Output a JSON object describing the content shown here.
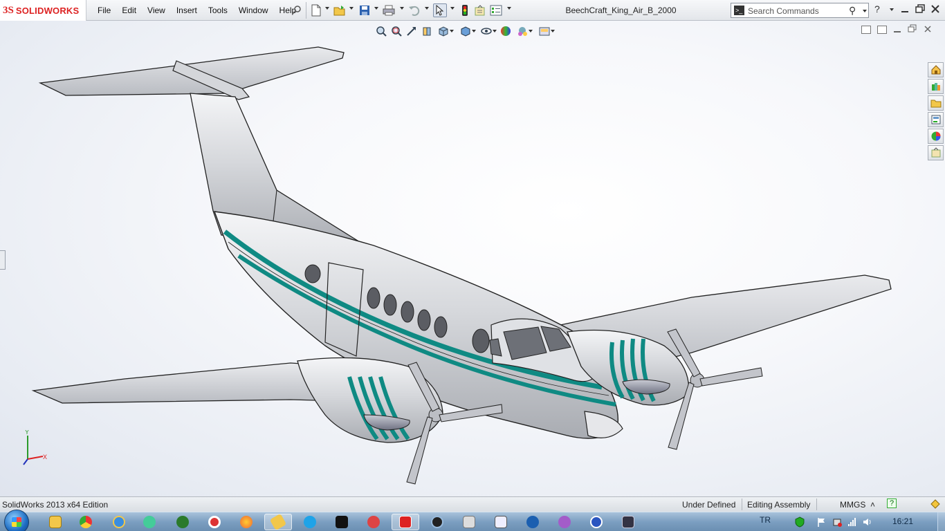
{
  "app": {
    "logo_prefix": "3S",
    "logo_name": "SOLIDWORKS",
    "document_title": "BeechCraft_King_Air_B_2000"
  },
  "menu": {
    "items": [
      "File",
      "Edit",
      "View",
      "Insert",
      "Tools",
      "Window",
      "Help"
    ]
  },
  "toolbar": {
    "icons": [
      "new-document-icon",
      "open-icon",
      "save-icon",
      "print-icon",
      "undo-icon",
      "select-icon",
      "rebuild-icon",
      "file-properties-icon",
      "options-icon"
    ]
  },
  "search": {
    "placeholder": "Search Commands",
    "help_glyph": "?"
  },
  "heads_up_toolbar": {
    "icons": [
      "zoom-to-fit-icon",
      "zoom-to-area-icon",
      "previous-view-icon",
      "section-view-icon",
      "view-orientation-icon",
      "display-style-icon",
      "hide-show-items-icon",
      "edit-appearance-icon",
      "apply-scene-icon",
      "view-settings-icon"
    ]
  },
  "task_pane": {
    "icons": [
      "solidworks-resources-icon",
      "design-library-icon",
      "file-explorer-icon",
      "view-palette-icon",
      "appearances-icon",
      "custom-properties-icon"
    ]
  },
  "triad": {
    "y_label": "Y",
    "x_label": "X"
  },
  "status_bar": {
    "edition": "SolidWorks 2013 x64 Edition",
    "definition": "Under Defined",
    "mode": "Editing Assembly",
    "units": "MMGS",
    "units_arrow": "˄",
    "help_glyph": "?"
  },
  "taskbar": {
    "language": "TR",
    "clock": "16:21",
    "pinned": [
      "explorer-icon",
      "chrome-icon",
      "ie-icon",
      "messenger-icon",
      "utorrent-icon",
      "opera-icon",
      "firefox-icon",
      "app-icon",
      "skype-icon",
      "cmd-icon",
      "photo-icon",
      "solidworks-icon",
      "media-icon",
      "calc-icon",
      "snip-icon",
      "speedfan-icon",
      "itunes-icon",
      "ts-icon",
      "monitor-icon"
    ]
  },
  "colors": {
    "accent_teal": "#0f8a83",
    "fuselage": "#d6d8dc",
    "logo_red": "#d22222"
  }
}
